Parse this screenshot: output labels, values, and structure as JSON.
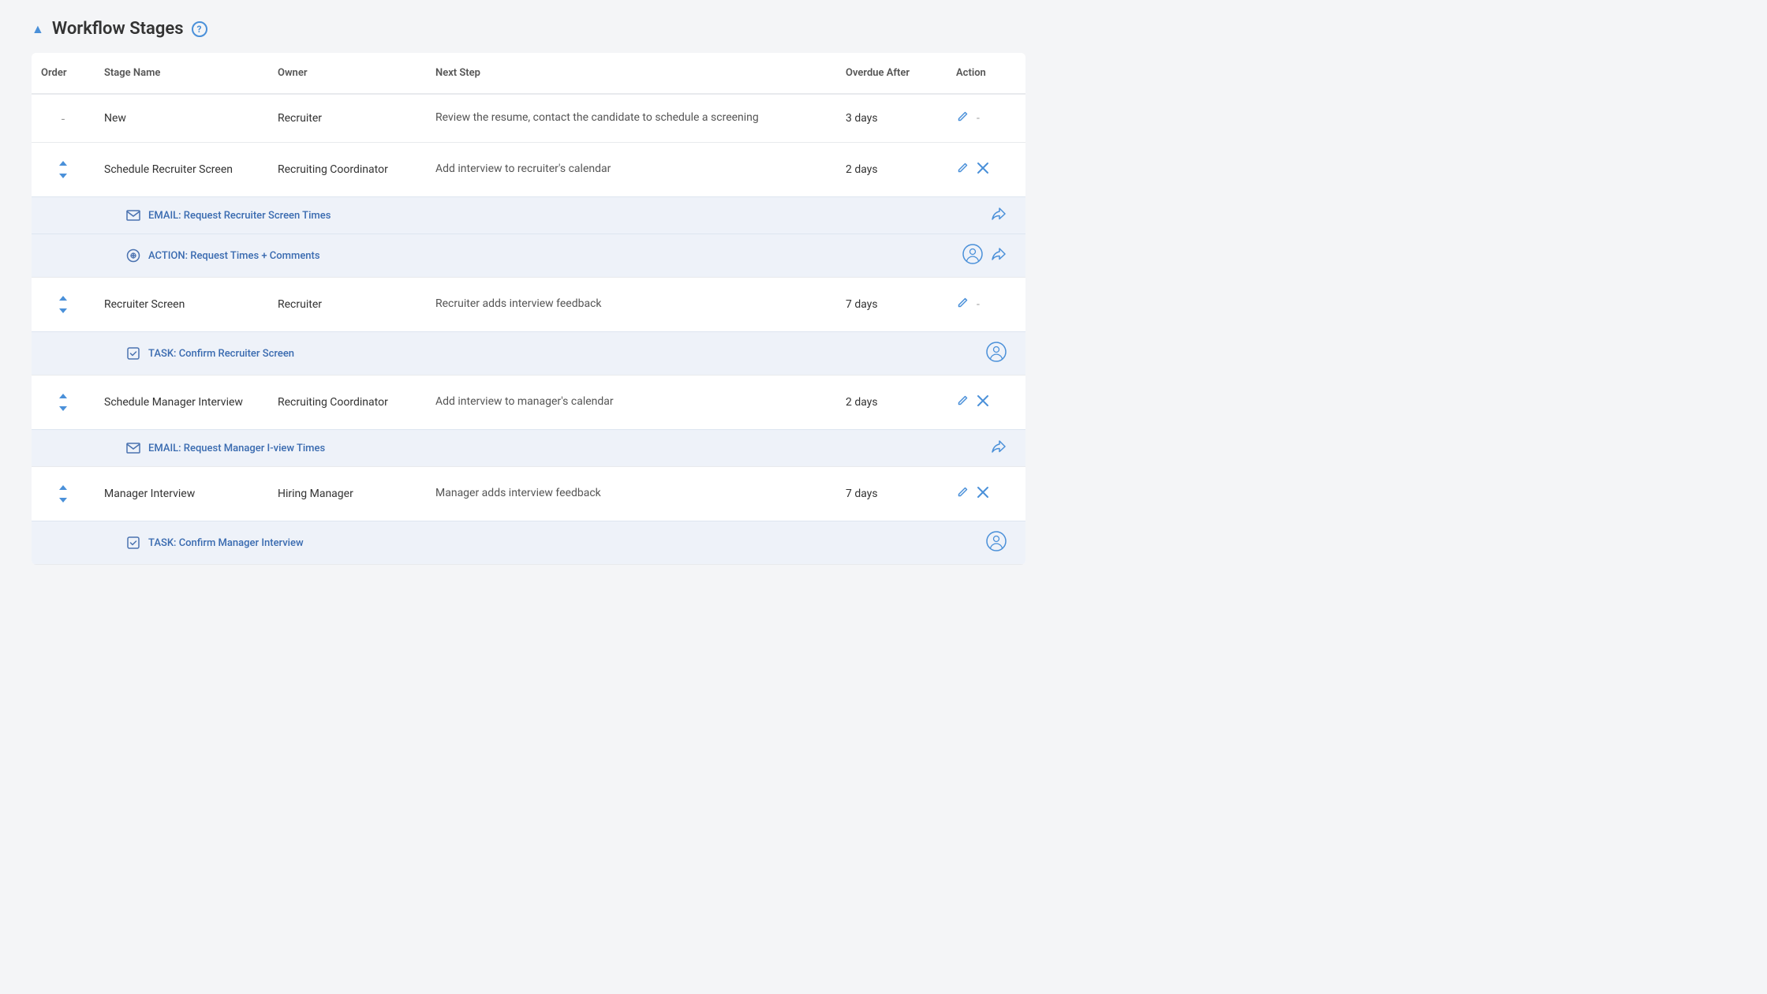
{
  "section": {
    "title": "Workflow Stages",
    "collapse_icon": "▲",
    "help_text": "?"
  },
  "columns": {
    "order": "Order",
    "stage_name": "Stage Name",
    "owner": "Owner",
    "next_step": "Next Step",
    "overdue_after": "Overdue After",
    "action": "Action"
  },
  "stages": [
    {
      "id": "new",
      "order": "-",
      "order_type": "dash",
      "name": "New",
      "owner": "Recruiter",
      "next_step": "Review the resume, contact the candidate to schedule a screening",
      "overdue_after": "3 days",
      "has_edit": true,
      "has_delete": false,
      "sub_items": []
    },
    {
      "id": "schedule-recruiter-screen",
      "order": "↕",
      "order_type": "arrows",
      "name": "Schedule Recruiter Screen",
      "owner": "Recruiting Coordinator",
      "next_step": "Add interview to recruiter's calendar",
      "overdue_after": "2 days",
      "has_edit": true,
      "has_delete": true,
      "sub_items": [
        {
          "type": "email",
          "label": "EMAIL: Request Recruiter Screen Times",
          "has_avatar": false,
          "has_share": true
        },
        {
          "type": "action",
          "label": "ACTION: Request Times + Comments",
          "has_avatar": true,
          "has_share": true
        }
      ]
    },
    {
      "id": "recruiter-screen",
      "order": "↕",
      "order_type": "arrows",
      "name": "Recruiter Screen",
      "owner": "Recruiter",
      "next_step": "Recruiter adds interview feedback",
      "overdue_after": "7 days",
      "has_edit": true,
      "has_delete": false,
      "sub_items": [
        {
          "type": "task",
          "label": "TASK: Confirm Recruiter Screen",
          "has_avatar": true,
          "has_share": false
        }
      ]
    },
    {
      "id": "schedule-manager-interview",
      "order": "↕",
      "order_type": "arrows",
      "name": "Schedule Manager Interview",
      "owner": "Recruiting Coordinator",
      "next_step": "Add interview to manager's calendar",
      "overdue_after": "2 days",
      "has_edit": true,
      "has_delete": true,
      "sub_items": [
        {
          "type": "email",
          "label": "EMAIL: Request Manager I-view Times",
          "has_avatar": false,
          "has_share": true
        }
      ]
    },
    {
      "id": "manager-interview",
      "order": "↕",
      "order_type": "arrows",
      "name": "Manager Interview",
      "owner": "Hiring Manager",
      "next_step": "Manager adds interview feedback",
      "overdue_after": "7 days",
      "has_edit": true,
      "has_delete": true,
      "sub_items": [
        {
          "type": "task",
          "label": "TASK: Confirm Manager Interview",
          "has_avatar": true,
          "has_share": false
        }
      ]
    }
  ],
  "icons": {
    "email": "✉",
    "action": "⚙",
    "task": "☑",
    "share": "↩",
    "edit": "✏",
    "delete": "✕",
    "arrows": "↕"
  },
  "colors": {
    "blue": "#4a90d9",
    "light_blue_bg": "#eef2f9",
    "border": "#e8eaed",
    "text_main": "#333",
    "text_muted": "#888"
  }
}
